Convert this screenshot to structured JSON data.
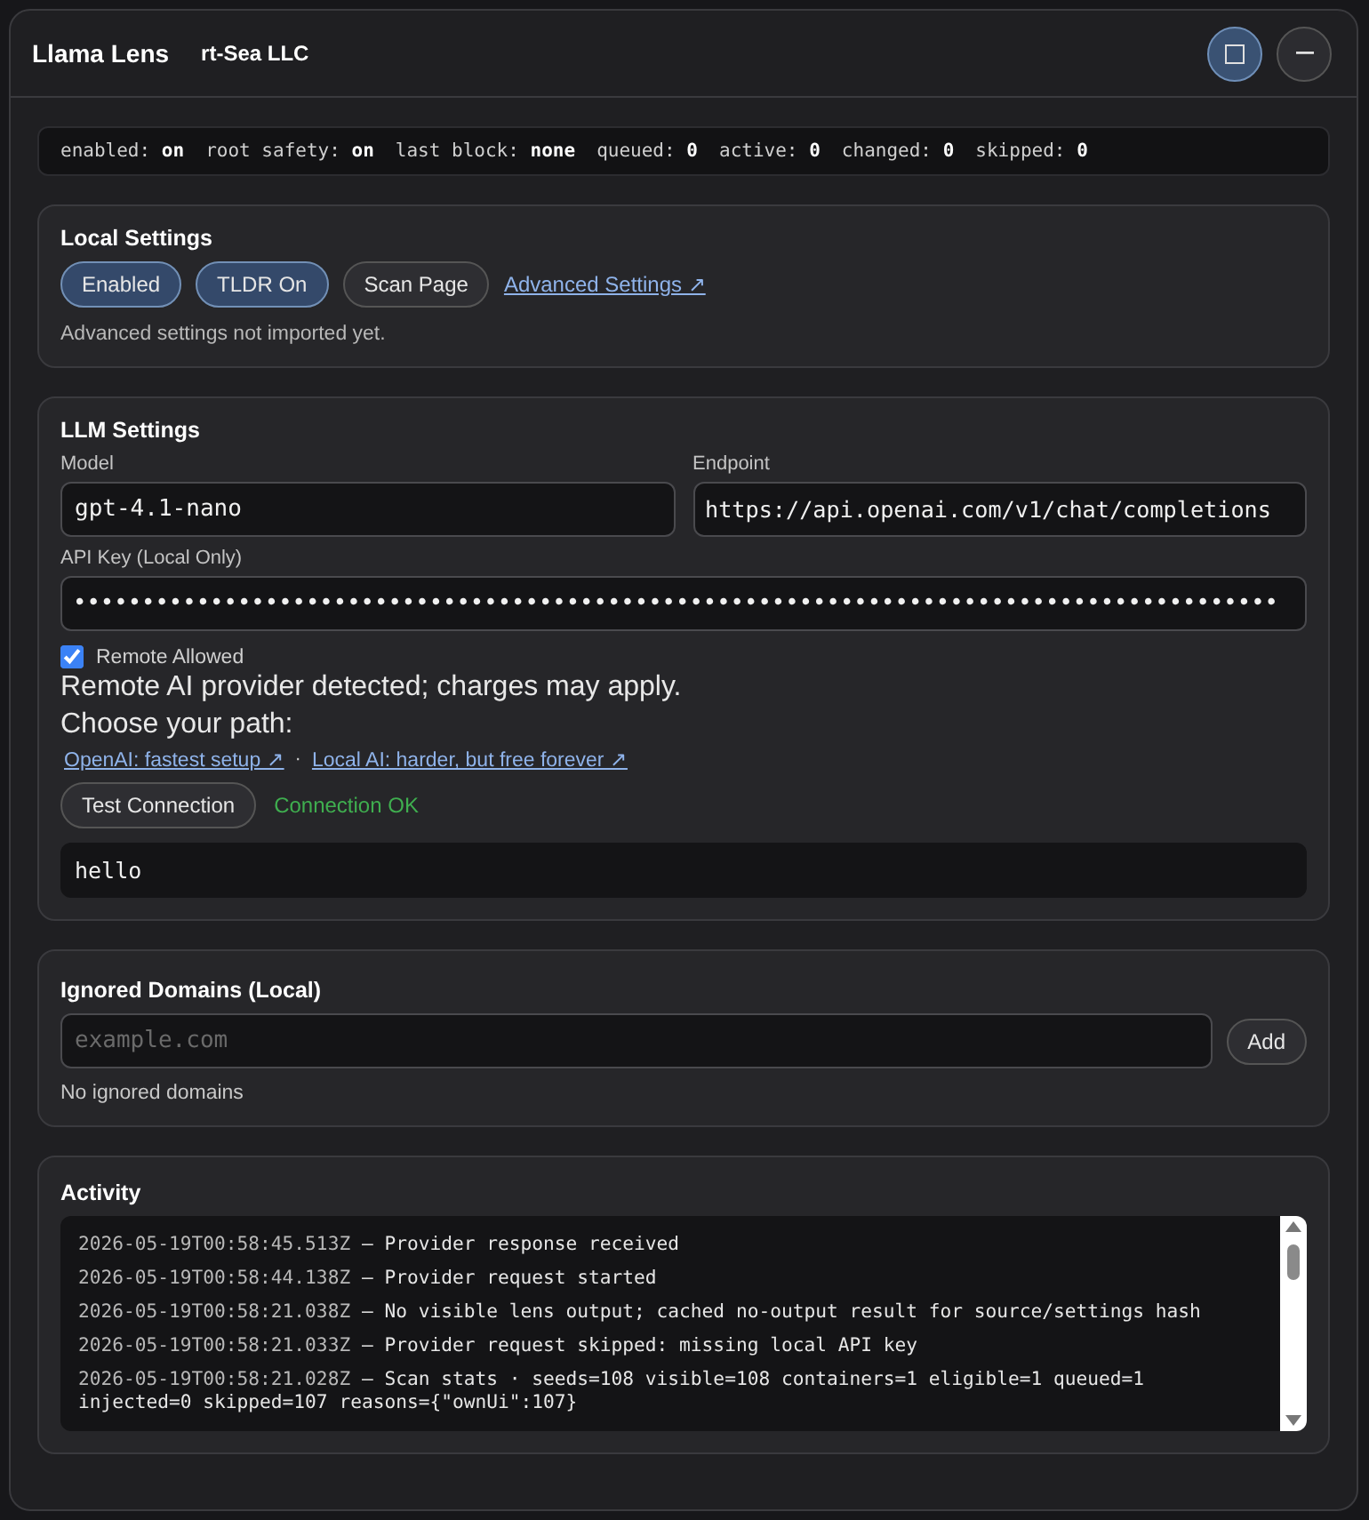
{
  "window": {
    "title": "Llama Lens",
    "subtitle": "rt-Sea LLC",
    "controls": [
      {
        "kind": "maximize",
        "selected": true
      },
      {
        "kind": "minimize",
        "selected": false
      }
    ]
  },
  "status": [
    {
      "label": "enabled:",
      "value": "on"
    },
    {
      "label": "root safety:",
      "value": "on"
    },
    {
      "label": "last block:",
      "value": "none"
    },
    {
      "label": "queued:",
      "value": "0"
    },
    {
      "label": "active:",
      "value": "0"
    },
    {
      "label": "changed:",
      "value": "0"
    },
    {
      "label": "skipped:",
      "value": "0"
    }
  ],
  "local_settings": {
    "title": "Local Settings",
    "buttons": [
      {
        "label": "Enabled",
        "on": true
      },
      {
        "label": "TLDR On",
        "on": true
      },
      {
        "label": "Scan Page",
        "on": false
      }
    ],
    "link": "Advanced Settings ↗",
    "note": "Advanced settings not imported yet."
  },
  "llm_settings": {
    "title": "LLM Settings",
    "model": {
      "label": "Model",
      "value": "gpt-4.1-nano"
    },
    "endpoint": {
      "label": "Endpoint",
      "value": "https://api.openai.com/v1/chat/completions"
    },
    "api_key": {
      "label": "API Key (Local Only)",
      "value": "••••••••••••••••••••••••••••••••••••••••••••••••••••••••••••••••••••••••••••••••••••••••"
    },
    "remote_allowed": {
      "label": "Remote Allowed",
      "checked": true
    },
    "warning": "Remote AI provider detected; charges may apply.",
    "choose": "Choose your path:",
    "links": [
      "OpenAI: fastest setup ↗",
      "Local AI: harder, but free forever ↗"
    ],
    "separator": "·",
    "test_button": "Test Connection",
    "test_result": "Connection OK",
    "response": "hello"
  },
  "ignored_domains": {
    "title": "Ignored Domains (Local)",
    "placeholder": "example.com",
    "add_button": "Add",
    "empty": "No ignored domains"
  },
  "activity": {
    "title": "Activity",
    "entries": [
      {
        "time": "2026-05-19T00:58:45.513Z",
        "message": "— Provider response received"
      },
      {
        "time": "2026-05-19T00:58:44.138Z",
        "message": "— Provider request started"
      },
      {
        "time": "2026-05-19T00:58:21.038Z",
        "message": "— No visible lens output; cached no-output result for source/settings hash"
      },
      {
        "time": "2026-05-19T00:58:21.033Z",
        "message": "— Provider request skipped: missing local API key"
      },
      {
        "time": "2026-05-19T00:58:21.028Z",
        "message": "— Scan stats · seeds=108 visible=108 containers=1 eligible=1 queued=1 injected=0 skipped=107 reasons={\"ownUi\":107}"
      }
    ]
  }
}
